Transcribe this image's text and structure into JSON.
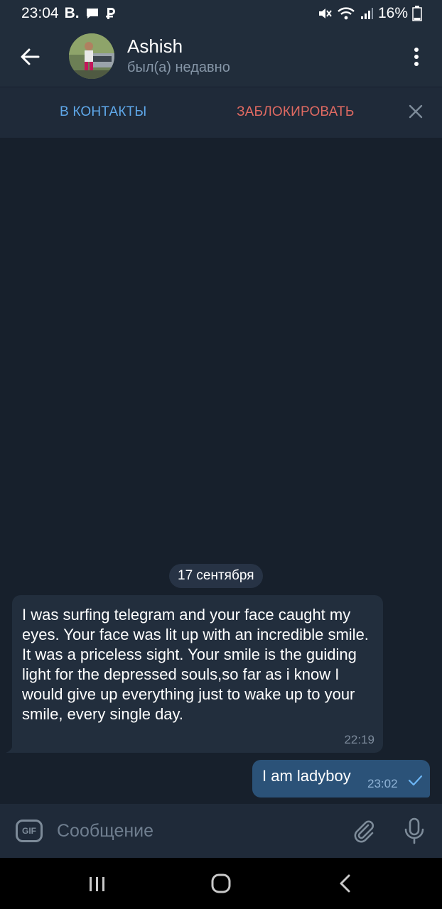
{
  "status_bar": {
    "time": "23:04",
    "app_badge": "B.",
    "battery": "16%"
  },
  "header": {
    "name": "Ashish",
    "status": "был(а) недавно"
  },
  "actions": {
    "add_contact": "В КОНТАКТЫ",
    "block": "ЗАБЛОКИРОВАТЬ"
  },
  "chat": {
    "date": "17 сентября",
    "messages": [
      {
        "direction": "in",
        "text": "I was surfing telegram and your face caught my eyes. Your face was lit up with an incredible smile. It was a priceless sight. Your smile is the guiding light for the depressed souls,so far as i know I would give up everything just to wake up to your smile, every single day.",
        "time": "22:19"
      },
      {
        "direction": "out",
        "text": "I am ladyboy",
        "time": "23:02"
      }
    ]
  },
  "input": {
    "gif_label": "GIF",
    "placeholder": "Сообщение"
  },
  "colors": {
    "accent_blue": "#5fa8ea",
    "block_red": "#e06a62",
    "outgoing_bubble": "#2b5278",
    "incoming_bubble": "#222e3d"
  }
}
